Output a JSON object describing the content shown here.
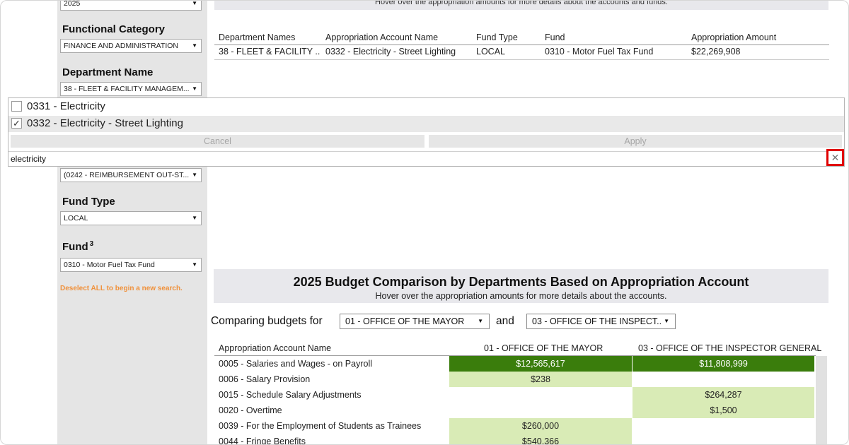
{
  "sidebar": {
    "year_value": "2025",
    "functional_category_label": "Functional Category",
    "functional_category_value": "FINANCE AND ADMINISTRATION",
    "department_name_label": "Department Name",
    "department_name_value": "38 - FLEET & FACILITY MANAGEM...",
    "appropriation_value": "(0242 - REIMBURSEMENT OUT-ST...",
    "fund_type_label": "Fund Type",
    "fund_type_value": "LOCAL",
    "fund_label": "Fund",
    "fund_sup": "3",
    "fund_value": "0310 - Motor Fuel Tax Fund",
    "deselect_text": "Deselect ALL to begin a new search."
  },
  "top_table": {
    "banner_text": "Hover over the appropriation amounts for more details about the accounts and funds.",
    "headers": [
      "Department Names",
      "Appropriation Account Name",
      "Fund Type",
      "Fund",
      "Appropriation Amount"
    ],
    "rows": [
      [
        "38 - FLEET & FACILITY ..",
        "0332 - Electricity - Street Lighting",
        "LOCAL",
        "0310 - Motor Fuel Tax Fund",
        "$22,269,908"
      ]
    ]
  },
  "popup": {
    "items": [
      {
        "label": "0331 - Electricity",
        "checked": false,
        "check": ""
      },
      {
        "label": "0332 - Electricity - Street Lighting",
        "checked": true,
        "check": "✓"
      }
    ],
    "cancel_label": "Cancel",
    "apply_label": "Apply",
    "search_value": "electricity",
    "clear_glyph": "✕"
  },
  "comparison": {
    "title": "2025 Budget Comparison by Departments Based on Appropriation Account",
    "subtitle": "Hover over the appropriation amounts for more details about the accounts.",
    "comparing_label": "Comparing budgets for",
    "dept1_select": "01 - OFFICE OF THE MAYOR",
    "and_label": "and",
    "dept2_select": "03 - OFFICE OF THE INSPECT..",
    "headers": [
      "Appropriation Account Name",
      "01 - OFFICE OF THE MAYOR",
      "03 - OFFICE OF THE INSPECTOR GENERAL"
    ],
    "rows": [
      {
        "name": "0005 - Salaries and Wages - on Payroll",
        "v1": "$12,565,617",
        "v2": "$11,808,999"
      },
      {
        "name": "0006 - Salary Provision",
        "v1": "$238",
        "v2": ""
      },
      {
        "name": "0015 - Schedule Salary Adjustments",
        "v1": "",
        "v2": "$264,287"
      },
      {
        "name": "0020 - Overtime",
        "v1": "",
        "v2": "$1,500"
      },
      {
        "name": "0039 - For the Employment of Students as Trainees",
        "v1": "$260,000",
        "v2": ""
      },
      {
        "name": "0044 - Fringe Benefits",
        "v1": "$540,366",
        "v2": ""
      }
    ],
    "colors": {
      "dark": "#3a7d0c",
      "light": "#d9ebb6"
    }
  }
}
